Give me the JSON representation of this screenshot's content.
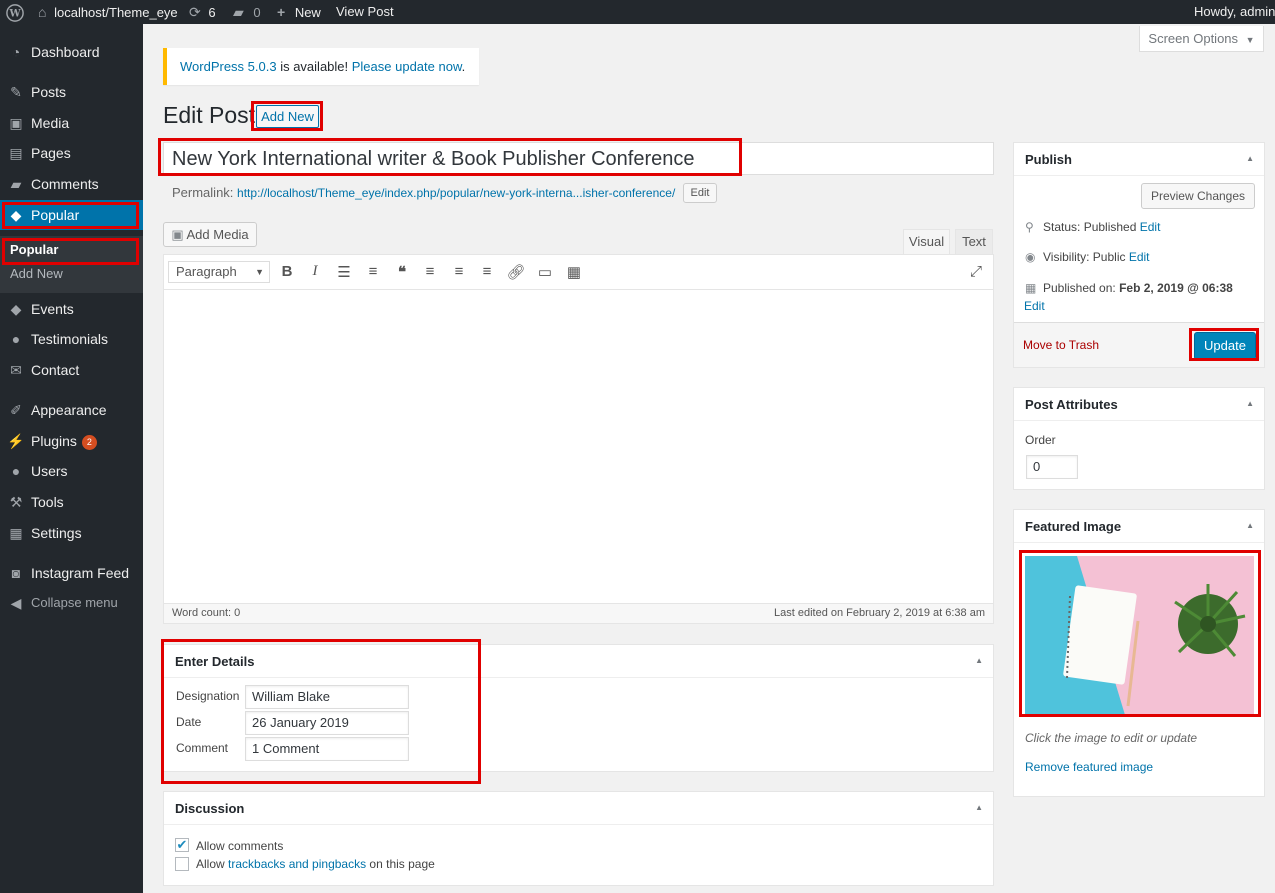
{
  "admin_bar": {
    "site_name": "localhost/Theme_eye",
    "updates_count": "6",
    "comments_count": "0",
    "new_label": "New",
    "view_post": "View Post",
    "howdy": "Howdy, admin"
  },
  "sidebar": {
    "items": [
      {
        "label": "Dashboard",
        "icon": "dashboard-icon"
      },
      {
        "label": "Posts",
        "icon": "pin-icon"
      },
      {
        "label": "Media",
        "icon": "media-icon"
      },
      {
        "label": "Pages",
        "icon": "pages-icon"
      },
      {
        "label": "Comments",
        "icon": "comment-icon"
      },
      {
        "label": "Popular",
        "icon": "tag-icon"
      },
      {
        "label": "Events",
        "icon": "tag-icon"
      },
      {
        "label": "Testimonials",
        "icon": "users-icon"
      },
      {
        "label": "Contact",
        "icon": "mail-icon"
      },
      {
        "label": "Appearance",
        "icon": "brush-icon"
      },
      {
        "label": "Plugins",
        "icon": "plugin-icon",
        "badge": "2"
      },
      {
        "label": "Users",
        "icon": "user-icon"
      },
      {
        "label": "Tools",
        "icon": "wrench-icon"
      },
      {
        "label": "Settings",
        "icon": "settings-icon"
      },
      {
        "label": "Instagram Feed",
        "icon": "camera-icon"
      }
    ],
    "submenu": [
      "Popular",
      "Add New"
    ],
    "collapse": "Collapse menu"
  },
  "notice": {
    "version_link": "WordPress 5.0.3",
    "middle": " is available! ",
    "update_link": "Please update now",
    "end": "."
  },
  "screen_options": "Screen Options",
  "page": {
    "title": "Edit Post",
    "add_new": "Add New"
  },
  "post": {
    "title": "New York International writer & Book Publisher Conference",
    "permalink_label": "Permalink:",
    "permalink_url": "http://localhost/Theme_eye/index.php/popular/new-york-interna...isher-conference/",
    "permalink_edit": "Edit"
  },
  "editor": {
    "add_media": "Add Media",
    "tab_visual": "Visual",
    "tab_text": "Text",
    "format_select": "Paragraph",
    "word_count": "Word count: 0",
    "last_edited": "Last edited on February 2, 2019 at 6:38 am"
  },
  "enter_details": {
    "title": "Enter Details",
    "designation_label": "Designation",
    "designation_value": "William Blake",
    "date_label": "Date",
    "date_value": "26 January 2019",
    "comment_label": "Comment",
    "comment_value": "1 Comment"
  },
  "discussion": {
    "title": "Discussion",
    "allow_comments": "Allow comments",
    "allow_prefix": "Allow ",
    "trackbacks_link": "trackbacks and pingbacks",
    "allow_suffix": " on this page"
  },
  "publish": {
    "title": "Publish",
    "preview": "Preview Changes",
    "status_label": "Status: ",
    "status_value": "Published",
    "visibility_label": "Visibility: ",
    "visibility_value": "Public",
    "published_on_label": "Published on: ",
    "published_on_value": "Feb 2, 2019 @ 06:38",
    "edit": "Edit",
    "move_to_trash": "Move to Trash",
    "update": "Update"
  },
  "post_attributes": {
    "title": "Post Attributes",
    "order_label": "Order",
    "order_value": "0"
  },
  "featured_image": {
    "title": "Featured Image",
    "hint": "Click the image to edit or update",
    "remove": "Remove featured image"
  },
  "colors": {
    "accent": "#0073aa",
    "highlight": "#e00000",
    "sidebar": "#23282d"
  }
}
